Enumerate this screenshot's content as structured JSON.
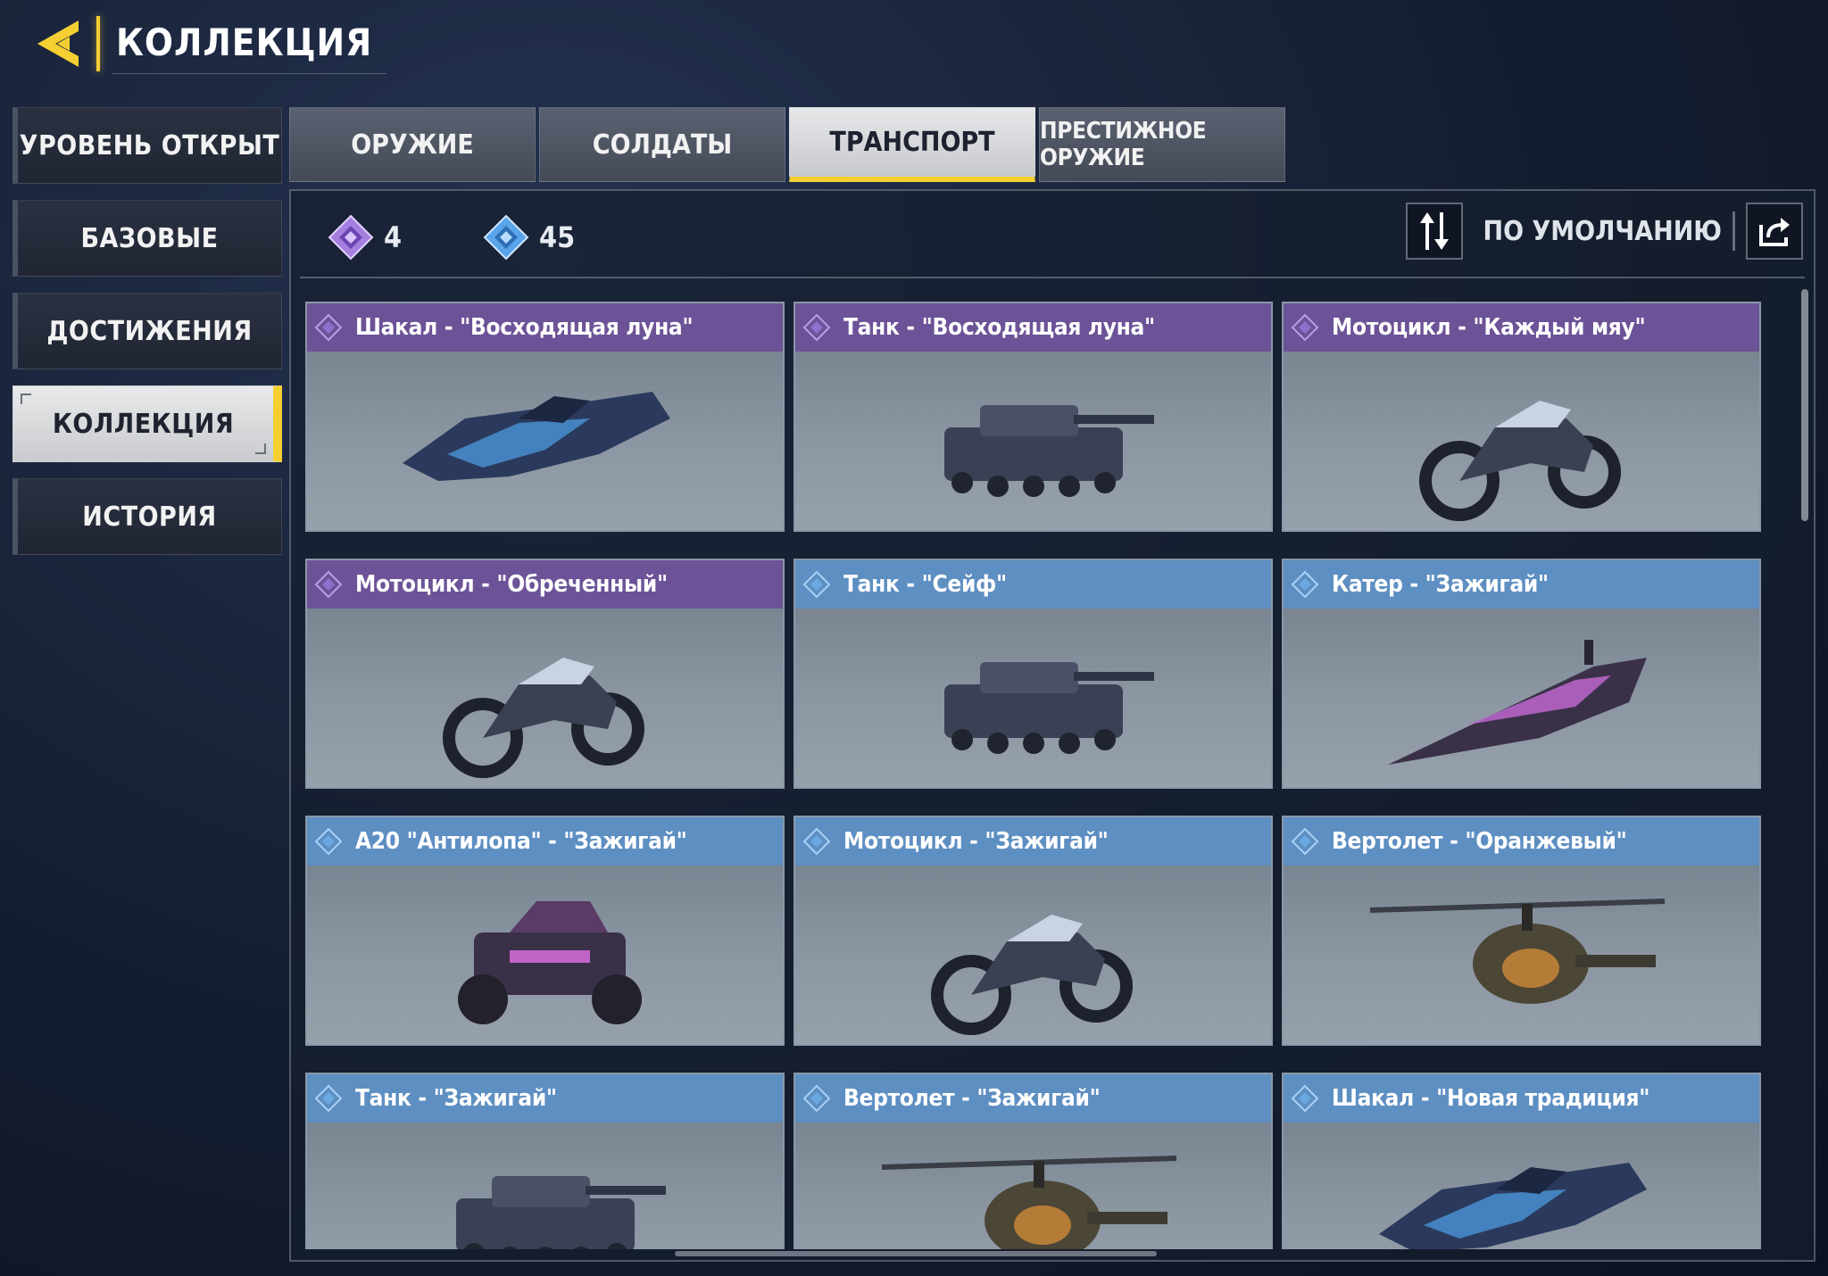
{
  "header": {
    "title": "КОЛЛЕКЦИЯ",
    "back_icon": "back-arrow-icon"
  },
  "sidebar": {
    "items": [
      {
        "label": "УРОВЕНЬ ОТКРЫТ"
      },
      {
        "label": "БАЗОВЫЕ"
      },
      {
        "label": "ДОСТИЖЕНИЯ"
      },
      {
        "label": "КОЛЛЕКЦИЯ",
        "active": true
      },
      {
        "label": "ИСТОРИЯ"
      }
    ]
  },
  "tabs": [
    {
      "label": "ОРУЖИЕ"
    },
    {
      "label": "СОЛДАТЫ"
    },
    {
      "label": "ТРАНСПОРТ",
      "active": true
    },
    {
      "label": "ПРЕСТИЖНОЕ ОРУЖИЕ"
    }
  ],
  "stats": {
    "legendary_count": "4",
    "epic_count": "45"
  },
  "sort": {
    "label": "ПО УМОЛЧАНИЮ"
  },
  "colors": {
    "accent": "#f5cf32",
    "legendary": "#6c5397",
    "epic": "#5e8fc2"
  },
  "cards": [
    {
      "name": "Шакал - \"Восходящая луна\"",
      "rarity": "legendary",
      "kind": "jackal"
    },
    {
      "name": "Танк - \"Восходящая луна\"",
      "rarity": "legendary",
      "kind": "tank"
    },
    {
      "name": "Мотоцикл - \"Каждый мяу\"",
      "rarity": "legendary",
      "kind": "moto"
    },
    {
      "name": "Мотоцикл - \"Обреченный\"",
      "rarity": "legendary",
      "kind": "moto"
    },
    {
      "name": "Танк - \"Сейф\"",
      "rarity": "epic",
      "kind": "tank"
    },
    {
      "name": "Катер - \"Зажигай\"",
      "rarity": "epic",
      "kind": "boat"
    },
    {
      "name": "A20 \"Антилопа\" - \"Зажигай\"",
      "rarity": "epic",
      "kind": "buggy"
    },
    {
      "name": "Мотоцикл - \"Зажигай\"",
      "rarity": "epic",
      "kind": "moto"
    },
    {
      "name": "Вертолет - \"Оранжевый\"",
      "rarity": "epic",
      "kind": "heli"
    },
    {
      "name": "Танк - \"Зажигай\"",
      "rarity": "epic",
      "kind": "tank"
    },
    {
      "name": "Вертолет - \"Зажигай\"",
      "rarity": "epic",
      "kind": "heli"
    },
    {
      "name": "Шакал - \"Новая традиция\"",
      "rarity": "epic",
      "kind": "jackal"
    }
  ]
}
